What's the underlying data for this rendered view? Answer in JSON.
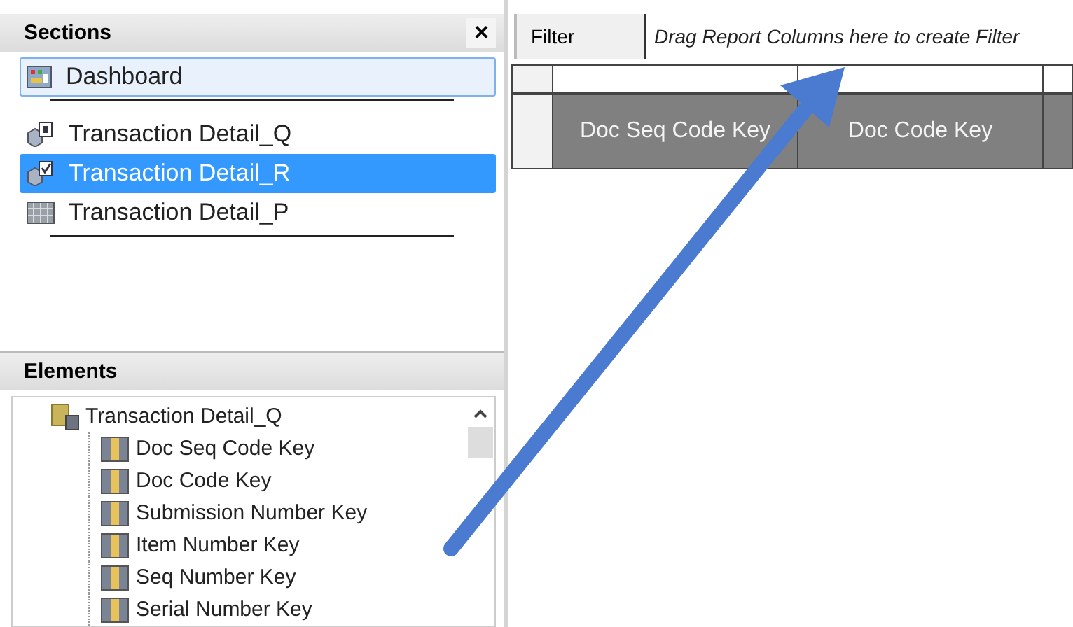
{
  "sections": {
    "title": "Sections",
    "close": "×",
    "items": [
      {
        "label": "Dashboard",
        "kind": "dashboard",
        "selected": false,
        "focused": true,
        "separator_after": true
      },
      {
        "label": "Transaction Detail_Q",
        "kind": "query",
        "selected": false,
        "focused": false,
        "separator_after": false
      },
      {
        "label": "Transaction Detail_R",
        "kind": "query_check",
        "selected": true,
        "focused": false,
        "separator_after": false
      },
      {
        "label": "Transaction Detail_P",
        "kind": "table",
        "selected": false,
        "focused": false,
        "separator_after": true
      }
    ]
  },
  "elements": {
    "title": "Elements",
    "tree": [
      {
        "label": "Transaction Detail_Q",
        "kind": "folder",
        "children": [
          {
            "label": "Doc Seq Code Key",
            "kind": "column"
          },
          {
            "label": "Doc Code Key",
            "kind": "column"
          },
          {
            "label": "Submission Number Key",
            "kind": "column"
          },
          {
            "label": "Item Number Key",
            "kind": "column"
          },
          {
            "label": "Seq Number Key",
            "kind": "column"
          },
          {
            "label": "Serial Number Key",
            "kind": "column"
          }
        ]
      }
    ]
  },
  "filter": {
    "label": "Filter",
    "placeholder": "Drag Report Columns here to create Filter"
  },
  "grid": {
    "columns": [
      {
        "label": "Doc Seq Code Key"
      },
      {
        "label": "Doc Code Key"
      }
    ]
  }
}
